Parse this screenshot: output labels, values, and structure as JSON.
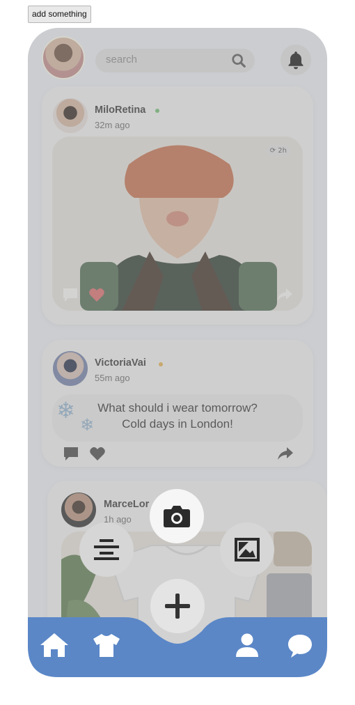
{
  "toolbar": {
    "add_label": "add something"
  },
  "header": {
    "search_placeholder": "search",
    "avatar_icon": "user-avatar",
    "search_icon": "search-icon",
    "bell_icon": "bell-icon"
  },
  "posts": [
    {
      "user": "MiloRetina",
      "time": "32m ago",
      "status_color": "#6fbf73",
      "timer": "2h",
      "type": "photo"
    },
    {
      "user": "VictoriaVai",
      "time": "55m ago",
      "status_color": "#e7b24a",
      "type": "text",
      "text_line1": "What should i wear tomorrow?",
      "text_line2": "Cold days in London!"
    },
    {
      "user": "MarceLor",
      "time": "1h ago",
      "type": "photo"
    }
  ],
  "post_actions": [
    "comment-icon",
    "heart-icon",
    "share-icon"
  ],
  "fab_menu": {
    "items": [
      "text-align-icon",
      "camera-icon",
      "image-icon",
      "plus-icon"
    ]
  },
  "bottom_nav": {
    "color": "#5b87c7",
    "items": [
      "home-icon",
      "shirt-icon",
      "profile-icon",
      "chat-icon"
    ]
  }
}
